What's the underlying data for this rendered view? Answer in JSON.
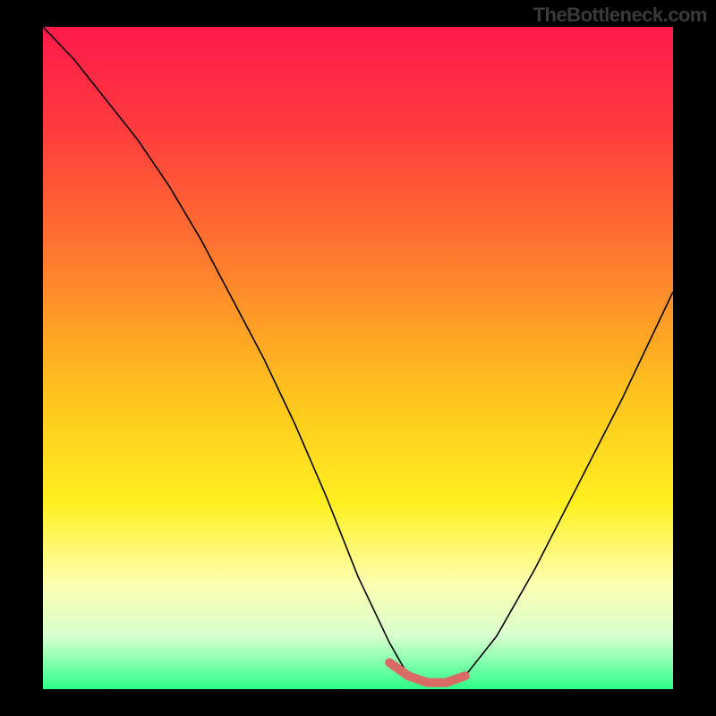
{
  "attribution": "TheBottleneck.com",
  "chart_data": {
    "type": "line",
    "title": "",
    "xlabel": "",
    "ylabel": "",
    "xlim": [
      0,
      100
    ],
    "ylim": [
      0,
      100
    ],
    "background_gradient": {
      "stops": [
        {
          "offset": 0.0,
          "color": "#ff1a4b"
        },
        {
          "offset": 0.15,
          "color": "#ff3a3e"
        },
        {
          "offset": 0.35,
          "color": "#ff7a2e"
        },
        {
          "offset": 0.55,
          "color": "#ffc21e"
        },
        {
          "offset": 0.72,
          "color": "#fff020"
        },
        {
          "offset": 0.84,
          "color": "#fdffb0"
        },
        {
          "offset": 0.92,
          "color": "#d8ffcf"
        },
        {
          "offset": 1.0,
          "color": "#2cff88"
        }
      ]
    },
    "series": [
      {
        "name": "bottleneck-curve",
        "color": "#000000",
        "width": 1.6,
        "x": [
          0,
          5,
          10,
          15,
          20,
          25,
          30,
          35,
          40,
          45,
          50,
          55,
          58,
          61,
          64,
          67,
          72,
          78,
          85,
          92,
          100
        ],
        "y": [
          100,
          95,
          89,
          83,
          76,
          68,
          59,
          50,
          40,
          29,
          17,
          7,
          2,
          1,
          1,
          2,
          8,
          18,
          31,
          44,
          60
        ]
      },
      {
        "name": "optimal-band",
        "color": "#da6b63",
        "width": 10,
        "x": [
          55,
          58,
          61,
          64,
          67
        ],
        "y": [
          4,
          2,
          1,
          1,
          2
        ]
      }
    ],
    "annotations": []
  }
}
